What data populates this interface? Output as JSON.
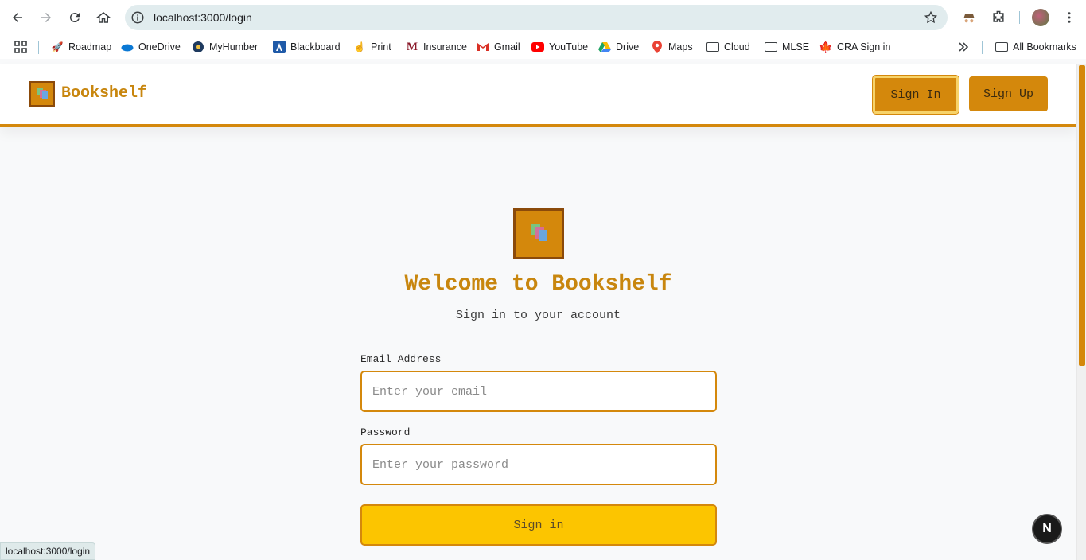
{
  "browser": {
    "url": "localhost:3000/login",
    "bookmarks": [
      {
        "label": "Roadmap",
        "icon": "rocket-icon"
      },
      {
        "label": "OneDrive",
        "icon": "cloud-icon"
      },
      {
        "label": "MyHumber",
        "icon": "humber-icon"
      },
      {
        "label": "Blackboard",
        "icon": "blackboard-icon"
      },
      {
        "label": "Print",
        "icon": "hand-icon"
      },
      {
        "label": "Insurance",
        "icon": "m-logo-icon"
      },
      {
        "label": "Gmail",
        "icon": "gmail-icon"
      },
      {
        "label": "YouTube",
        "icon": "youtube-icon"
      },
      {
        "label": "Drive",
        "icon": "drive-icon"
      },
      {
        "label": "Maps",
        "icon": "maps-icon"
      },
      {
        "label": "Cloud",
        "icon": "folder-icon"
      },
      {
        "label": "MLSE",
        "icon": "folder-icon"
      },
      {
        "label": "CRA Sign in",
        "icon": "maple-leaf-icon"
      }
    ],
    "all_bookmarks": "All Bookmarks",
    "status_url": "localhost:3000/login"
  },
  "header": {
    "brand": "Bookshelf",
    "sign_in": "Sign In",
    "sign_up": "Sign Up"
  },
  "login": {
    "title": "Welcome to Bookshelf",
    "subtitle": "Sign in to your account",
    "email_label": "Email Address",
    "email_placeholder": "Enter your email",
    "password_label": "Password",
    "password_placeholder": "Enter your password",
    "submit": "Sign in"
  },
  "dev_badge": "N",
  "colors": {
    "accent": "#d4880c",
    "accent_dark": "#8b4a0a",
    "submit_bg": "#fcc500",
    "brand_text": "#c8860e"
  }
}
